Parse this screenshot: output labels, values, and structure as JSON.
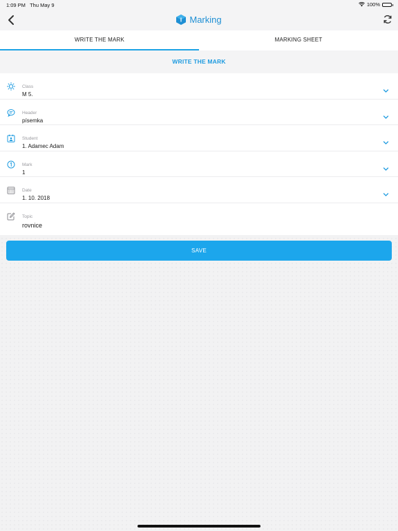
{
  "status_bar": {
    "time": "1:09 PM",
    "date": "Thu May 9",
    "battery": "100%"
  },
  "nav": {
    "title": "Marking",
    "icons": {
      "back": "chevron-left-icon",
      "logo": "app-logo-icon",
      "refresh": "refresh-icon"
    }
  },
  "tabs": [
    {
      "label": "WRITE THE MARK",
      "active": true
    },
    {
      "label": "MARKING SHEET",
      "active": false
    }
  ],
  "section_title": "WRITE THE MARK",
  "form": {
    "class": {
      "label": "Class",
      "value": "M 5.",
      "icon": "sun-icon"
    },
    "header": {
      "label": "Header",
      "value": "písemka",
      "icon": "speech-bubble-icon"
    },
    "student": {
      "label": "Student",
      "value": "1. Adamec Adam",
      "icon": "calendar-person-icon"
    },
    "mark": {
      "label": "Mark",
      "value": "1",
      "icon": "number-circle-icon"
    },
    "date": {
      "label": "Date",
      "value": "1. 10. 2018",
      "icon": "calendar-icon"
    },
    "topic": {
      "label": "Topic",
      "value": "rovnice",
      "icon": "edit-icon"
    }
  },
  "save_label": "SAVE",
  "colors": {
    "accent": "#1ca6ec",
    "title": "#1e8fd4",
    "background": "#f2f2f3"
  }
}
